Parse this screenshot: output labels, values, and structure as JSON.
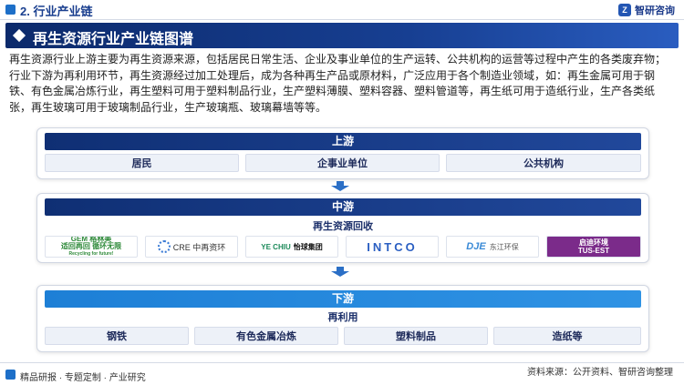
{
  "header": {
    "section": "2. 行业产业链",
    "brand": "智研咨询",
    "brand_mark": "Z"
  },
  "title": "再生资源行业产业链图谱",
  "paragraph": "再生资源行业上游主要为再生资源来源，包括居民日常生活、企业及事业单位的生产运转、公共机构的运营等过程中产生的各类废弃物；行业下游为再利用环节，再生资源经过加工处理后，成为各种再生产品或原材料，广泛应用于各个制造业领域，如：再生金属可用于钢铁、有色金属冶炼行业，再生塑料可用于塑料制品行业，生产塑料薄膜、塑料容器、塑料管道等，再生纸可用于造纸行业，生产各类纸张，再生玻璃可用于玻璃制品行业，生产玻璃瓶、玻璃幕墙等等。",
  "upstream": {
    "label": "上游",
    "items": [
      "居民",
      "企事业单位",
      "公共机构"
    ]
  },
  "midstream": {
    "label": "中游",
    "sublabel": "再生资源回收",
    "logos": {
      "l1_line1": "GEM 格林美",
      "l1_line2": "适回再回  循环无限",
      "l1_en": "Recycling for future!",
      "l2": "CRE 中再资环",
      "l3_mark": "YE CHIU",
      "l3": "怡球集团",
      "l4": "INTCO",
      "l5_mark": "DJE",
      "l5": "东江环保",
      "l6_line1": "启迪环境",
      "l6_line2": "TUS-EST"
    }
  },
  "downstream": {
    "label": "下游",
    "sublabel": "再利用",
    "items": [
      "钢铁",
      "有色金属冶炼",
      "塑料制品",
      "造纸等"
    ]
  },
  "footer": {
    "left": "精品研报 · 专题定制 · 产业研究",
    "source": "资料来源：公开资料、智研咨询整理"
  },
  "colors": {
    "navy": "#0f2f74",
    "accent": "#1d7fd6",
    "brand": "#1d6fc8"
  }
}
